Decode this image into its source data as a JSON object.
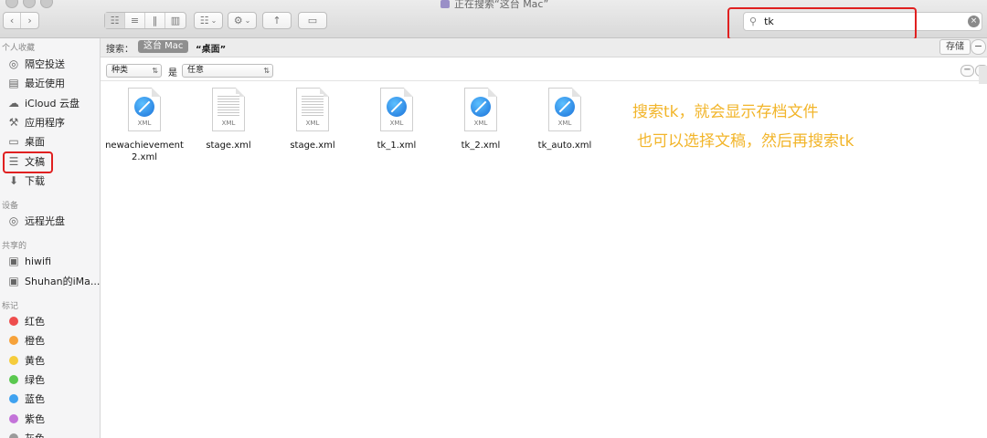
{
  "window": {
    "title": "正在搜索“这台 Mac”"
  },
  "toolbar": {
    "back": "‹",
    "forward": "›",
    "view_icon": "☷",
    "list_view": "≡",
    "column_view": "‖",
    "flow_view": "▥",
    "group_menu": "☷",
    "gear": "⚙",
    "chevron": "⌄",
    "share": "↑",
    "tag": "▭",
    "search_value": "tk",
    "search_icon": "⚲",
    "clear": "×"
  },
  "sidebar": {
    "sections": [
      {
        "title": "个人收藏"
      },
      {
        "title": "设备"
      },
      {
        "title": "共享的"
      },
      {
        "title": "标记"
      }
    ],
    "favorites": [
      {
        "label": "隔空投送",
        "icon": "◎"
      },
      {
        "label": "最近使用",
        "icon": "▤"
      },
      {
        "label": "iCloud 云盘",
        "icon": "☁"
      },
      {
        "label": "应用程序",
        "icon": "⚒"
      },
      {
        "label": "桌面",
        "icon": "▭"
      },
      {
        "label": "文稿",
        "icon": "☰"
      },
      {
        "label": "下载",
        "icon": "⬇"
      }
    ],
    "devices": [
      {
        "label": "远程光盘",
        "icon": "◎"
      }
    ],
    "shared": [
      {
        "label": "hiwifi",
        "icon": "▣"
      },
      {
        "label": "Shuhan的iMa...",
        "icon": "▣"
      }
    ],
    "tags": [
      {
        "label": "红色",
        "color": "#ee4d4d"
      },
      {
        "label": "橙色",
        "color": "#f6a23a"
      },
      {
        "label": "黄色",
        "color": "#f5cc3c"
      },
      {
        "label": "绿色",
        "color": "#5ac84f"
      },
      {
        "label": "蓝色",
        "color": "#3fa2f0"
      },
      {
        "label": "紫色",
        "color": "#c373d9"
      },
      {
        "label": "灰色",
        "color": "#9b9b9b"
      }
    ]
  },
  "scope": {
    "label": "搜索：",
    "this_mac": "这台 Mac",
    "desktop": "“桌面”",
    "save": "存储",
    "minus": "−"
  },
  "criteria": {
    "kind": "种类",
    "is": "是",
    "any": "任意",
    "minus": "−",
    "plus": "+",
    "arrows": "⇅"
  },
  "files": [
    {
      "name": "newachievement2.xml",
      "ext": "XML",
      "kind": "safari"
    },
    {
      "name": "stage.xml",
      "ext": "XML",
      "kind": "text"
    },
    {
      "name": "stage.xml",
      "ext": "XML",
      "kind": "text"
    },
    {
      "name": "tk_1.xml",
      "ext": "XML",
      "kind": "safari"
    },
    {
      "name": "tk_2.xml",
      "ext": "XML",
      "kind": "safari"
    },
    {
      "name": "tk_auto.xml",
      "ext": "XML",
      "kind": "safari"
    }
  ],
  "annotation": {
    "line1": "搜索tk，就会显示存档文件",
    "line2": "也可以选择文稿，然后再搜索tk",
    "color": "#f2b52a"
  }
}
